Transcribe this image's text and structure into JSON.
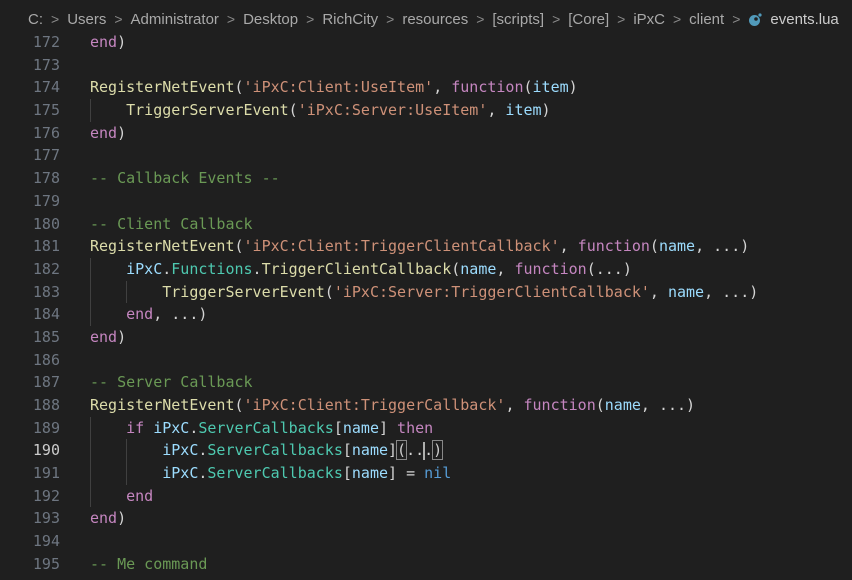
{
  "breadcrumb": {
    "items": [
      "C:",
      "Users",
      "Administrator",
      "Desktop",
      "RichCity",
      "resources",
      "[scripts]",
      "[Core]",
      "iPxC",
      "client"
    ],
    "file": "events.lua",
    "separator": ">"
  },
  "editor": {
    "current_line": "190",
    "lines": [
      {
        "num": "172",
        "parts": [
          [
            "kw",
            "end"
          ],
          [
            "punc",
            ")"
          ]
        ]
      },
      {
        "num": "173",
        "parts": []
      },
      {
        "num": "174",
        "parts": [
          [
            "fn",
            "RegisterNetEvent"
          ],
          [
            "punc",
            "("
          ],
          [
            "str",
            "'iPxC:Client:UseItem'"
          ],
          [
            "punc",
            ", "
          ],
          [
            "kw",
            "function"
          ],
          [
            "punc",
            "("
          ],
          [
            "var",
            "item"
          ],
          [
            "punc",
            ")"
          ]
        ]
      },
      {
        "num": "175",
        "parts": [
          [
            "fn",
            "TriggerServerEvent"
          ],
          [
            "punc",
            "("
          ],
          [
            "str",
            "'iPxC:Server:UseItem'"
          ],
          [
            "punc",
            ", "
          ],
          [
            "var",
            "item"
          ],
          [
            "punc",
            ")"
          ]
        ]
      },
      {
        "num": "176",
        "parts": [
          [
            "kw",
            "end"
          ],
          [
            "punc",
            ")"
          ]
        ]
      },
      {
        "num": "177",
        "parts": []
      },
      {
        "num": "178",
        "parts": [
          [
            "cmt",
            "-- Callback Events --"
          ]
        ]
      },
      {
        "num": "179",
        "parts": []
      },
      {
        "num": "180",
        "parts": [
          [
            "cmt",
            "-- Client Callback"
          ]
        ]
      },
      {
        "num": "181",
        "parts": [
          [
            "fn",
            "RegisterNetEvent"
          ],
          [
            "punc",
            "("
          ],
          [
            "str",
            "'iPxC:Client:TriggerClientCallback'"
          ],
          [
            "punc",
            ", "
          ],
          [
            "kw",
            "function"
          ],
          [
            "punc",
            "("
          ],
          [
            "var",
            "name"
          ],
          [
            "punc",
            ", ...)"
          ]
        ]
      },
      {
        "num": "182",
        "parts": [
          [
            "var",
            "iPxC"
          ],
          [
            "punc",
            "."
          ],
          [
            "prop",
            "Functions"
          ],
          [
            "punc",
            "."
          ],
          [
            "fn",
            "TriggerClientCallback"
          ],
          [
            "punc",
            "("
          ],
          [
            "var",
            "name"
          ],
          [
            "punc",
            ", "
          ],
          [
            "kw",
            "function"
          ],
          [
            "punc",
            "(...)"
          ]
        ]
      },
      {
        "num": "183",
        "parts": [
          [
            "fn",
            "TriggerServerEvent"
          ],
          [
            "punc",
            "("
          ],
          [
            "str",
            "'iPxC:Server:TriggerClientCallback'"
          ],
          [
            "punc",
            ", "
          ],
          [
            "var",
            "name"
          ],
          [
            "punc",
            ", ...)"
          ]
        ]
      },
      {
        "num": "184",
        "parts": [
          [
            "kw",
            "end"
          ],
          [
            "punc",
            ", ...)"
          ]
        ]
      },
      {
        "num": "185",
        "parts": [
          [
            "kw",
            "end"
          ],
          [
            "punc",
            ")"
          ]
        ]
      },
      {
        "num": "186",
        "parts": []
      },
      {
        "num": "187",
        "parts": [
          [
            "cmt",
            "-- Server Callback"
          ]
        ]
      },
      {
        "num": "188",
        "parts": [
          [
            "fn",
            "RegisterNetEvent"
          ],
          [
            "punc",
            "("
          ],
          [
            "str",
            "'iPxC:Client:TriggerCallback'"
          ],
          [
            "punc",
            ", "
          ],
          [
            "kw",
            "function"
          ],
          [
            "punc",
            "("
          ],
          [
            "var",
            "name"
          ],
          [
            "punc",
            ", ...)"
          ]
        ]
      },
      {
        "num": "189",
        "parts": [
          [
            "kw",
            "if "
          ],
          [
            "var",
            "iPxC"
          ],
          [
            "punc",
            "."
          ],
          [
            "prop",
            "ServerCallbacks"
          ],
          [
            "punc",
            "["
          ],
          [
            "var",
            "name"
          ],
          [
            "punc",
            "] "
          ],
          [
            "kw",
            "then"
          ]
        ]
      },
      {
        "num": "190",
        "parts": [
          [
            "var",
            "iPxC"
          ],
          [
            "punc",
            "."
          ],
          [
            "prop",
            "ServerCallbacks"
          ],
          [
            "punc",
            "["
          ],
          [
            "var",
            "name"
          ],
          [
            "punc",
            "]"
          ],
          [
            "bracket",
            "("
          ],
          [
            "punc",
            "..."
          ],
          [
            "bracket",
            ")"
          ]
        ]
      },
      {
        "num": "191",
        "parts": [
          [
            "var",
            "iPxC"
          ],
          [
            "punc",
            "."
          ],
          [
            "prop",
            "ServerCallbacks"
          ],
          [
            "punc",
            "["
          ],
          [
            "var",
            "name"
          ],
          [
            "punc",
            "] = "
          ],
          [
            "nil",
            "nil"
          ]
        ]
      },
      {
        "num": "192",
        "parts": [
          [
            "kw",
            "end"
          ]
        ]
      },
      {
        "num": "193",
        "parts": [
          [
            "kw",
            "end"
          ],
          [
            "punc",
            ")"
          ]
        ]
      },
      {
        "num": "194",
        "parts": []
      },
      {
        "num": "195",
        "parts": [
          [
            "cmt",
            "-- Me command"
          ]
        ]
      }
    ]
  }
}
